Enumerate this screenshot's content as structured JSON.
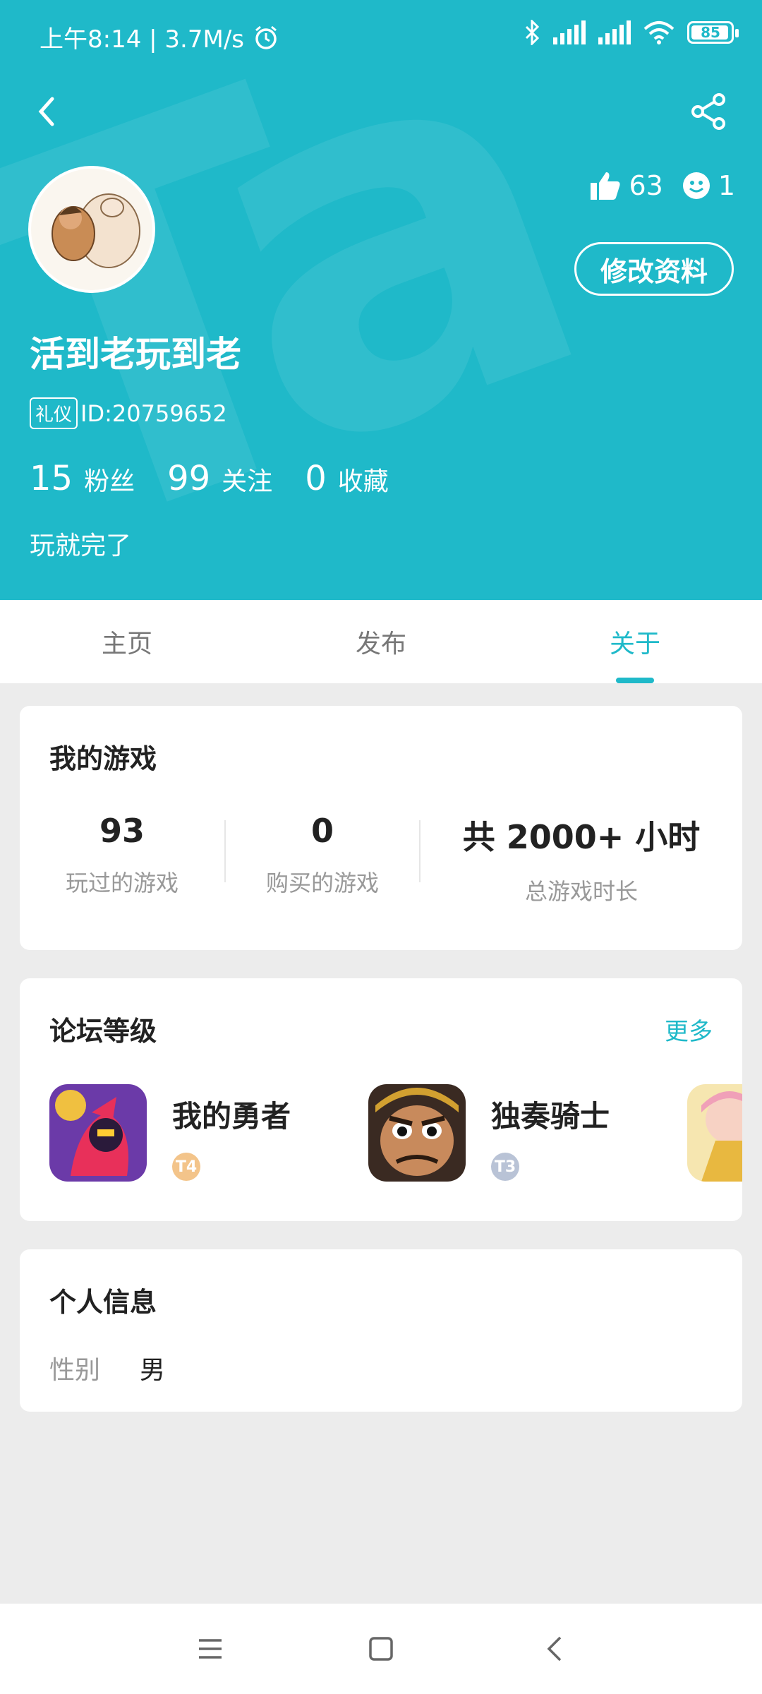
{
  "status": {
    "time_speed": "上午8:14 | 3.7M/s",
    "battery": "85"
  },
  "profile": {
    "likes": "63",
    "friends": "1",
    "edit_label": "修改资料",
    "username": "活到老玩到老",
    "badge": "礼仪",
    "id_text": "ID:20759652",
    "fans_count": "15",
    "fans_label": "粉丝",
    "following_count": "99",
    "following_label": "关注",
    "fav_count": "0",
    "fav_label": "收藏",
    "bio": "玩就完了"
  },
  "tabs": [
    {
      "label": "主页"
    },
    {
      "label": "发布"
    },
    {
      "label": "关于"
    }
  ],
  "my_games": {
    "title": "我的游戏",
    "stats": [
      {
        "value": "93",
        "label": "玩过的游戏"
      },
      {
        "value": "0",
        "label": "购买的游戏"
      },
      {
        "value": "共 2000+ 小时",
        "label": "总游戏时长"
      }
    ]
  },
  "forum": {
    "title": "论坛等级",
    "more": "更多",
    "items": [
      {
        "name": "我的勇者",
        "level": "T4",
        "level_color": "#f3c48a"
      },
      {
        "name": "独奏骑士",
        "level": "T3",
        "level_color": "#b9c3d6"
      }
    ]
  },
  "personal": {
    "title": "个人信息",
    "gender_key": "性别",
    "gender_value": "男"
  },
  "colors": {
    "accent": "#1fb9c9",
    "background": "#ececec"
  }
}
